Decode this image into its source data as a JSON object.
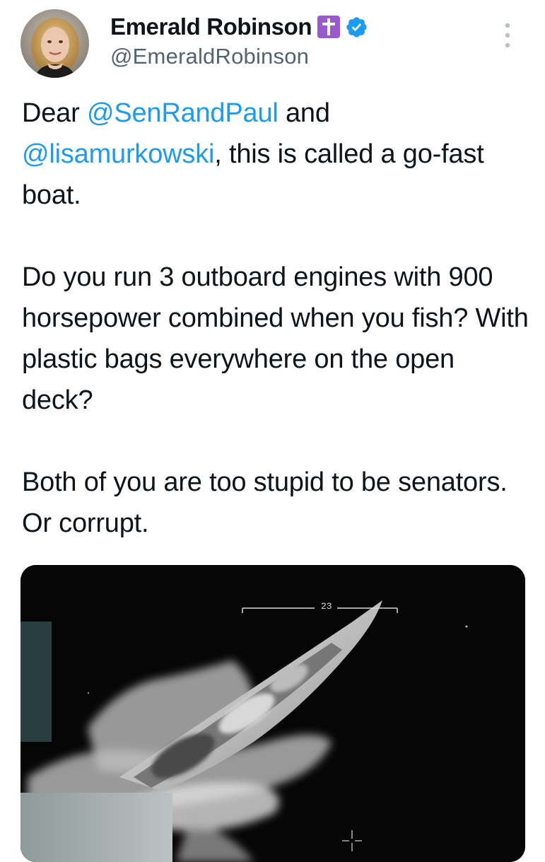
{
  "author": {
    "name": "Emerald Robinson",
    "handle": "@EmeraldRobinson",
    "badge_icon": "cross-emoji-icon",
    "verified_icon": "verified-badge-icon",
    "verified_color": "#1d9bf0",
    "cross_color": "#9b59d0"
  },
  "menu": {
    "icon": "more-options-icon"
  },
  "tweet": {
    "p1": {
      "t1": "Dear ",
      "m1": "@SenRandPaul",
      "t2": " and",
      "m2": "@lisamurkowski",
      "t3": ", this is called a go-fast boat."
    },
    "p2": "Do you run 3 outboard engines with 900 horsepower combined when you fish? With plastic bags everywhere on the open deck?",
    "p3": "Both of you are too stupid to be senators. Or corrupt."
  },
  "media": {
    "type": "thermal-image-of-boat",
    "hud_number": "23"
  },
  "colors": {
    "text": "#0f1419",
    "secondary": "#536471",
    "link": "#1d9bf0"
  }
}
